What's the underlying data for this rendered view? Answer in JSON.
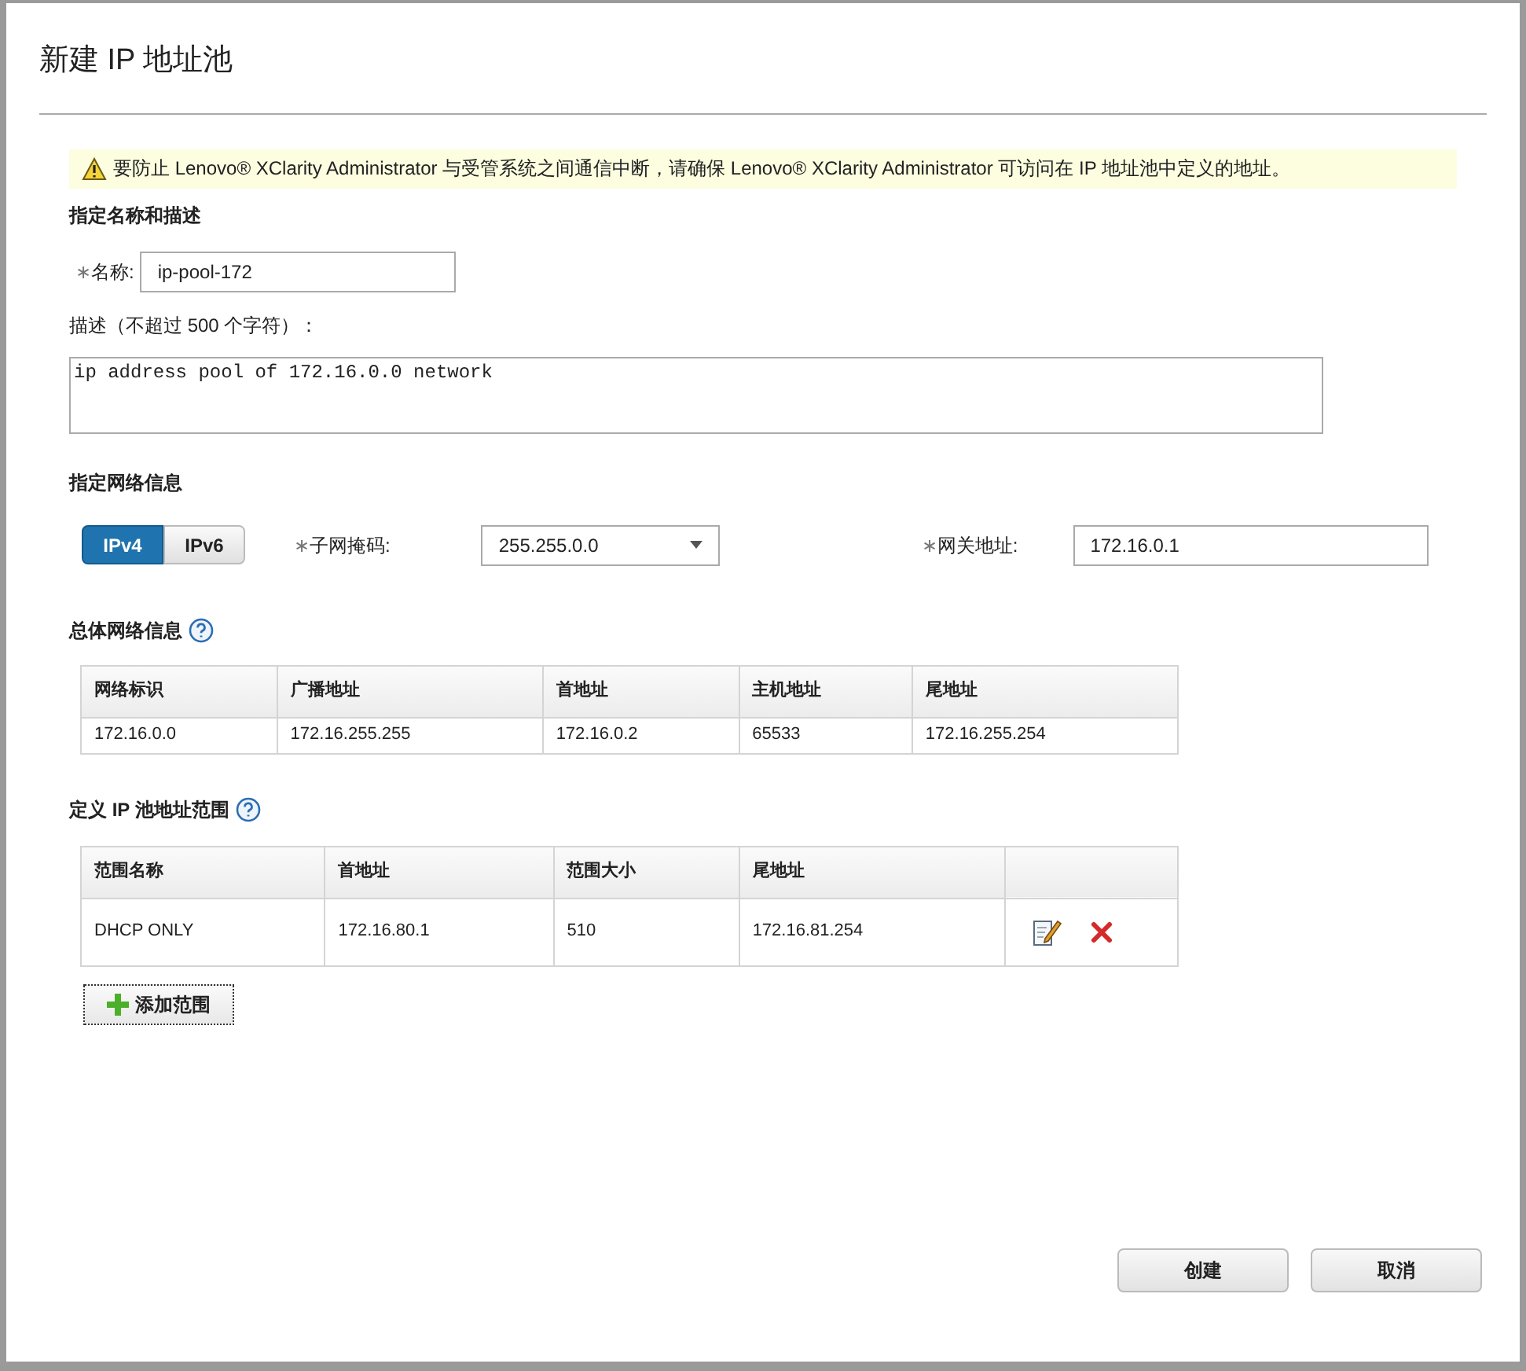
{
  "dialog": {
    "title": "新建 IP 地址池"
  },
  "warning": "要防止 Lenovo® XClarity Administrator 与受管系统之间通信中断，请确保 Lenovo® XClarity Administrator 可访问在 IP 地址池中定义的地址。",
  "name_section": {
    "heading": "指定名称和描述",
    "name_mark": "∗",
    "name_label": "名称:",
    "name_value": "ip-pool-172",
    "desc_label": "描述（不超过 500 个字符）：",
    "desc_value": "ip address pool of 172.16.0.0 network"
  },
  "network_section": {
    "heading": "指定网络信息",
    "tabs": [
      {
        "label": "IPv4",
        "selected": true
      },
      {
        "label": "IPv6",
        "selected": false
      }
    ],
    "mask_mark": "∗",
    "mask_label": "子网掩码:",
    "mask_value": "255.255.0.0",
    "gateway_mark": "∗",
    "gateway_label": "网关地址:",
    "gateway_value": "172.16.0.1"
  },
  "overall": {
    "heading": "总体网络信息",
    "columns": [
      "网络标识",
      "广播地址",
      "首地址",
      "主机地址",
      "尾地址"
    ],
    "rows": [
      [
        "172.16.0.0",
        "172.16.255.255",
        "172.16.0.2",
        "65533",
        "172.16.255.254"
      ]
    ]
  },
  "ranges": {
    "heading": "定义 IP 池地址范围",
    "columns": [
      "范围名称",
      "首地址",
      "范围大小",
      "尾地址"
    ],
    "rows": [
      [
        "DHCP ONLY",
        "172.16.80.1",
        "510",
        "172.16.81.254"
      ]
    ],
    "add_button": "添加范围"
  },
  "buttons": [
    "创建",
    "取消"
  ]
}
